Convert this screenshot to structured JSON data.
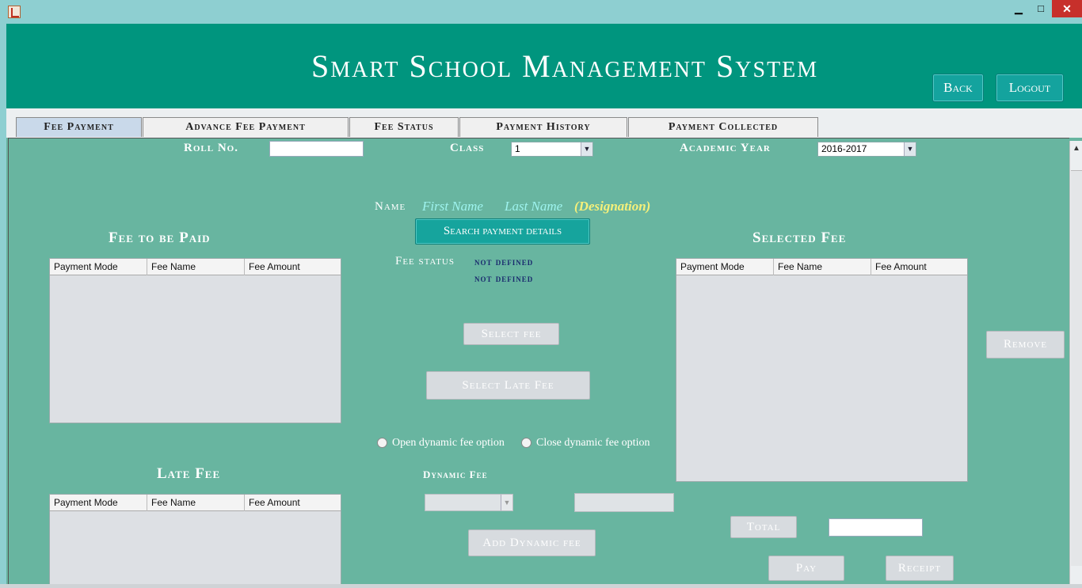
{
  "window": {
    "minimize_glyph": "▁",
    "maximize_glyph": "□",
    "close_glyph": "✕"
  },
  "header": {
    "title": "Smart School Management System",
    "back_label": "Back",
    "logout_label": "Logout"
  },
  "tabs": [
    {
      "label": "Fee Payment"
    },
    {
      "label": "Advance Fee Payment"
    },
    {
      "label": "Fee Status"
    },
    {
      "label": "Payment History"
    },
    {
      "label": "Payment Collected"
    }
  ],
  "filters": {
    "roll_label": "Roll No.",
    "roll_value": "",
    "class_label": "Class",
    "class_value": "1",
    "year_label": "Academic Year",
    "year_value": "2016-2017"
  },
  "student": {
    "name_label": "Name",
    "first_name": "First Name",
    "last_name": "Last Name",
    "designation": "(Designation)"
  },
  "search_button": "Search payment details",
  "fee_status": {
    "label": "Fee status",
    "value1": "not defined",
    "value2": "not defined"
  },
  "fee_to_be_paid": {
    "title": "Fee to be Paid",
    "columns": [
      "Payment Mode",
      "Fee Name",
      "Fee Amount"
    ]
  },
  "selected_fee": {
    "title": "Selected Fee",
    "columns": [
      "Payment Mode",
      "Fee Name",
      "Fee Amount"
    ]
  },
  "late_fee": {
    "title": "Late Fee",
    "columns": [
      "Payment Mode",
      "Fee Name",
      "Fee Amount"
    ]
  },
  "buttons": {
    "select_fee": "Select fee",
    "select_late_fee": "Select Late Fee",
    "remove": "Remove",
    "add_dynamic_fee": "Add Dynamic fee",
    "total": "Total",
    "pay": "Pay",
    "receipt": "Receipt"
  },
  "dynamic": {
    "open_option": "Open dynamic fee option",
    "close_option": "Close dynamic fee option",
    "label": "Dynamic Fee",
    "select_value": "",
    "amount_value": ""
  },
  "total_value": "",
  "colors": {
    "header": "#00957e",
    "panel": "#68b5a0",
    "accent_button": "#16a49d",
    "designation": "#f5f07a",
    "name_placeholder": "#9ef3ee"
  }
}
